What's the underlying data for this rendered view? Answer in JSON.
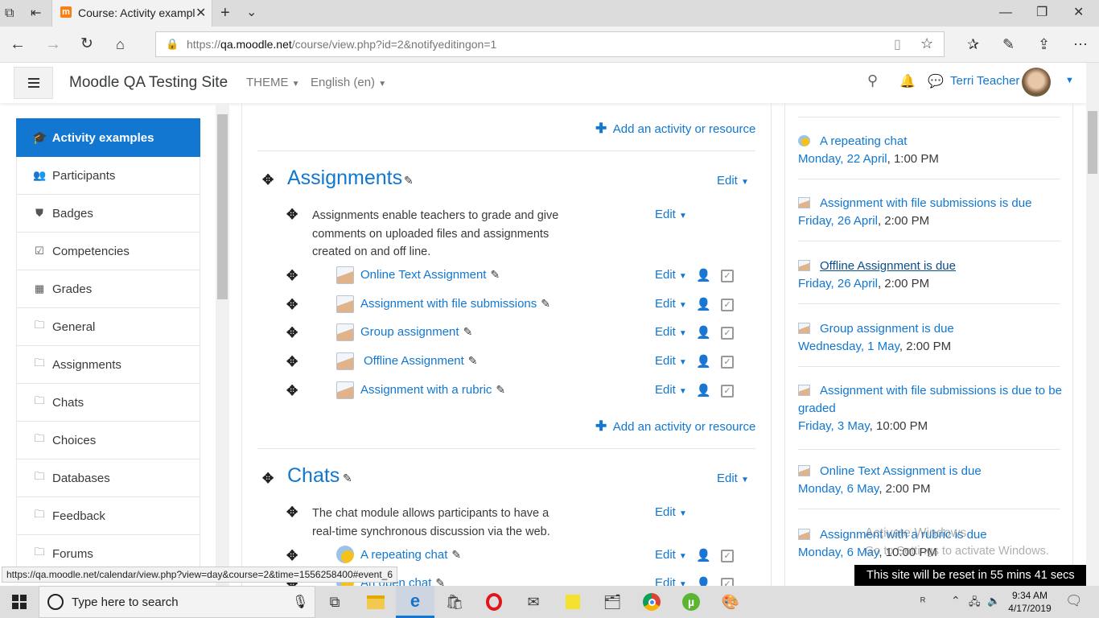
{
  "browser": {
    "tab_title": "Course: Activity exampl",
    "url_prefix": "https://",
    "url_host": "qa.moodle.net",
    "url_path": "/course/view.php?id=2&notifyeditingon=1",
    "status_url": "https://qa.moodle.net/calendar/view.php?view=day&course=2&time=1556258400#event_6"
  },
  "header": {
    "site_name": "Moodle QA Testing Site",
    "theme": "THEME",
    "language": "English (en)",
    "user_name": "Terri Teacher"
  },
  "nav": {
    "course": "Activity examples",
    "items": [
      {
        "label": "Participants",
        "icon": "users-icon"
      },
      {
        "label": "Badges",
        "icon": "shield-icon"
      },
      {
        "label": "Competencies",
        "icon": "check-square-icon"
      },
      {
        "label": "Grades",
        "icon": "table-icon"
      },
      {
        "label": "General",
        "icon": "folder-icon"
      },
      {
        "label": "Assignments",
        "icon": "folder-icon"
      },
      {
        "label": "Chats",
        "icon": "folder-icon"
      },
      {
        "label": "Choices",
        "icon": "folder-icon"
      },
      {
        "label": "Databases",
        "icon": "folder-icon"
      },
      {
        "label": "Feedback",
        "icon": "folder-icon"
      },
      {
        "label": "Forums",
        "icon": "folder-icon"
      }
    ]
  },
  "main": {
    "add_activity": "Add an activity or resource",
    "edit": "Edit",
    "assignments": {
      "title": "Assignments",
      "summary_lines": [
        "Assignments enable teachers to grade and give",
        "comments on uploaded files and assignments",
        "created on and off line."
      ],
      "activities": [
        "Online Text Assignment",
        "Assignment with file submissions",
        "Group assignment",
        "Offline Assignment",
        "Assignment with a rubric"
      ]
    },
    "chats": {
      "title": "Chats",
      "summary_lines": [
        "The chat module allows participants to have a",
        "real-time synchronous discussion via the web."
      ],
      "activities": [
        "A repeating chat",
        "An open chat"
      ]
    }
  },
  "upcoming": [
    {
      "title": "A repeating chat",
      "date": "Monday, 22 April",
      "time": ", 1:00 PM",
      "icon": "chat-icon"
    },
    {
      "title": "Assignment with file submissions is due",
      "date": "Friday, 26 April",
      "time": ", 2:00 PM",
      "icon": "assignment-icon"
    },
    {
      "title": "Offline Assignment is due",
      "date": "Friday, 26 April",
      "time": ", 2:00 PM",
      "icon": "assignment-icon"
    },
    {
      "title": "Group assignment is due",
      "date": "Wednesday, 1 May",
      "time": ", 2:00 PM",
      "icon": "assignment-icon"
    },
    {
      "title_1": "Assignment with file submissions is due to be",
      "title_2": "graded",
      "date": "Friday, 3 May",
      "time": ", 10:00 PM",
      "icon": "assignment-icon"
    },
    {
      "title": "Online Text Assignment is due",
      "date": "Monday, 6 May",
      "time": ", 2:00 PM",
      "icon": "assignment-icon"
    },
    {
      "title": "Assignment with a rubric is due",
      "date": "Monday, 6 May",
      "time": ", 10:00 PM",
      "icon": "assignment-icon"
    }
  ],
  "watermark": {
    "line1": "Activate Windows",
    "line2": "Go to Settings to activate Windows."
  },
  "reset_notice": "This site will be reset in 55 mins 41 secs",
  "taskbar": {
    "search_placeholder": "Type here to search",
    "time": "9:34 AM",
    "date": "4/17/2019"
  },
  "colors": {
    "accent": "#1177d1",
    "nav_active": "#1177d1"
  }
}
